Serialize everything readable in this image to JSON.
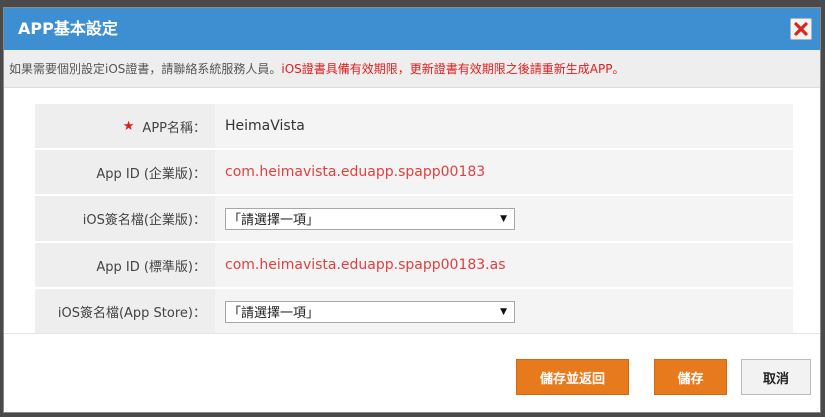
{
  "dialog": {
    "title": "APP基本設定",
    "close_icon": "close-icon"
  },
  "notice": {
    "text_grey": "如果需要個別設定iOS證書，請聯絡系統服務人員。",
    "text_red": "iOS證書具備有效期限，更新證書有效期限之後請重新生成APP。"
  },
  "form": {
    "rows": [
      {
        "label": "APP名稱：",
        "value": "HeimaVista",
        "required": true
      },
      {
        "label": "App ID (企業版)：",
        "value": "com.heimavista.eduapp.spapp00183"
      },
      {
        "label": "iOS簽名檔(企業版)：",
        "select": "「請選擇一項」"
      },
      {
        "label": "App ID (標準版)：",
        "value": "com.heimavista.eduapp.spapp00183.as"
      },
      {
        "label": "iOS簽名檔(App Store)：",
        "select": "「請選擇一項」"
      }
    ],
    "required_mark": "★"
  },
  "buttons": {
    "save_return": "儲存並返回",
    "save": "儲存",
    "cancel": "取消"
  },
  "colors": {
    "titlebar": "#3e8fd1",
    "accent_orange": "#e87a1e",
    "red_text": "#e21d1d"
  }
}
